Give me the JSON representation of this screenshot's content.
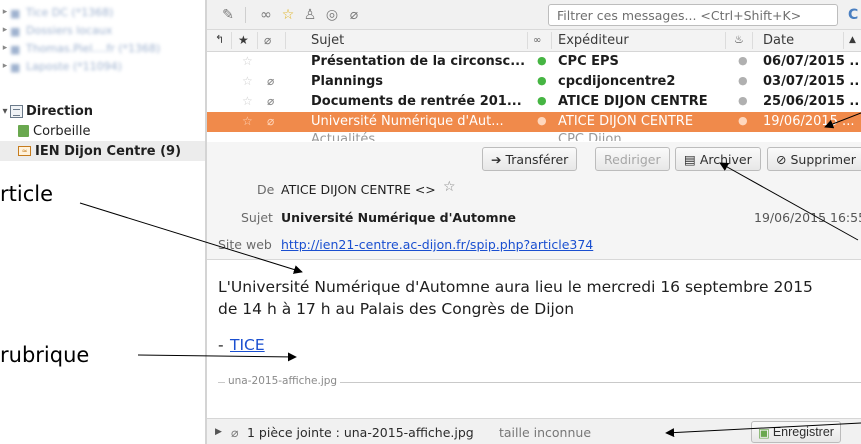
{
  "folder_pane": {
    "blurred_accounts": [
      "Tice DC (*1368)",
      "Dossiers locaux",
      "Thomas.Piel....fr (*1368)",
      "Laposte (*11094)"
    ],
    "direction_label": "Direction",
    "trash_label": "Corbeille",
    "feed_label": "IEN Dijon Centre (9)"
  },
  "toolbar": {
    "filter_placeholder": "Filtrer ces messages... <Ctrl+Shift+K>"
  },
  "thread_header": {
    "subject": "Sujet",
    "sender": "Expéditeur",
    "date": "Date"
  },
  "threads": [
    {
      "subject": "Présentation de la circonsc...",
      "sender": "CPC EPS",
      "date": "06/07/2015 ..."
    },
    {
      "subject": "Plannings",
      "sender": "cpcdijoncentre2",
      "date": "03/07/2015 ..."
    },
    {
      "subject": "Documents de rentrée 201...",
      "sender": "ATICE DIJON CENTRE",
      "date": "25/06/2015 ..."
    },
    {
      "subject": "Université Numérique d'Aut...",
      "sender": "ATICE DIJON CENTRE",
      "date": "19/06/2015 ..."
    },
    {
      "subject": "Actualités ...",
      "sender": "CPC Dijon ...",
      "date": "..."
    }
  ],
  "message_header": {
    "from_label": "De",
    "from_value": "ATICE DIJON CENTRE <>",
    "forward_label": "Transférer",
    "redirect_label": "Rediriger",
    "archive_label": "Archiver",
    "delete_label": "Supprimer",
    "subject_label": "Sujet",
    "subject_value": "Université Numérique d'Automne",
    "date_value": "19/06/2015 16:55",
    "website_label": "Site web",
    "website_url": "http://ien21-centre.ac-dijon.fr/spip.php?article374"
  },
  "message_body": {
    "line1": "L'Université Numérique d'Automne aura lieu le mercredi 16 septembre 2015",
    "line2": "de 14 h à 17 h au Palais des Congrès de Dijon",
    "link_prefix": "- ",
    "link_text": "TICE",
    "attachment_divider": "una-2015-affiche.jpg"
  },
  "attachment_bar": {
    "summary": "1 pièce jointe : una-2015-affiche.jpg",
    "size": "taille inconnue",
    "save_label": "Enregistrer"
  },
  "annotations": {
    "article_label": "rticle",
    "rubrique_label": "rubrique"
  }
}
